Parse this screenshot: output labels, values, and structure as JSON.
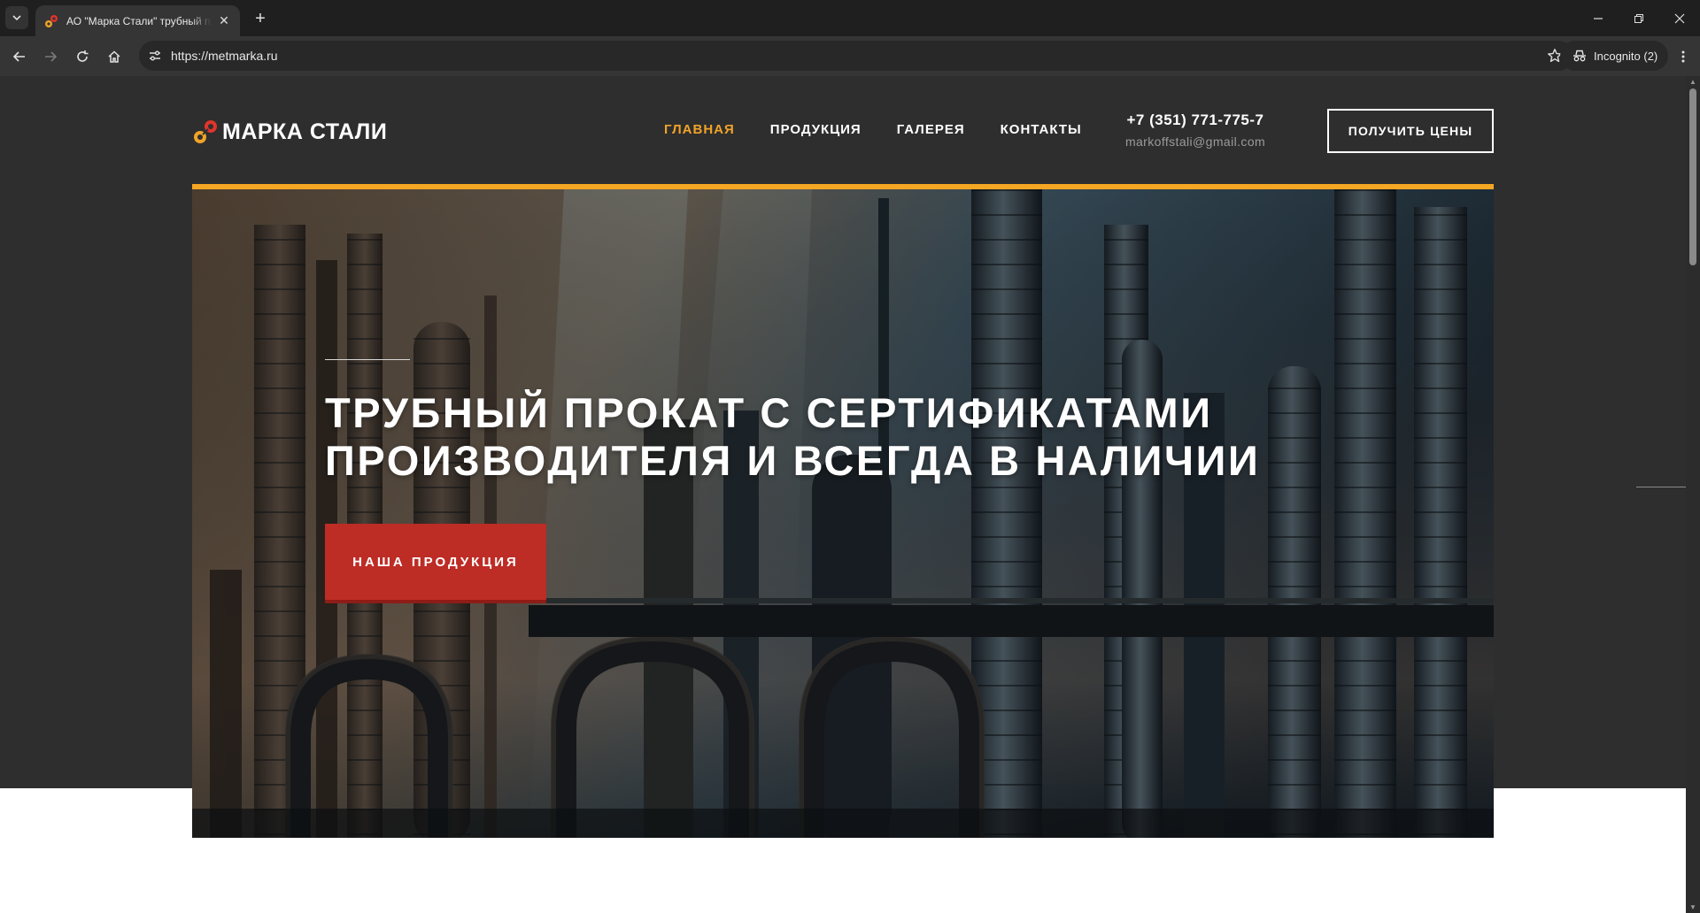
{
  "browser": {
    "tab_title": "АО \"Марка Стали\" трубный прокат",
    "url": "https://metmarka.ru",
    "incognito_label": "Incognito (2)"
  },
  "site": {
    "logo_text": "МАРКА СТАЛИ",
    "nav": [
      {
        "label": "ГЛАВНАЯ",
        "active": true
      },
      {
        "label": "ПРОДУКЦИЯ",
        "active": false
      },
      {
        "label": "ГАЛЕРЕЯ",
        "active": false
      },
      {
        "label": "КОНТАКТЫ",
        "active": false
      }
    ],
    "phone": "+7 (351) 771-775-7",
    "email": "markoffstali@gmail.com",
    "price_button": "ПОЛУЧИТЬ ЦЕНЫ"
  },
  "hero": {
    "headline_line1": "ТРУБНЫЙ ПРОКАТ С СЕРТИФИКАТАМИ",
    "headline_line2": "ПРОИЗВОДИТЕЛЯ И ВСЕГДА В НАЛИЧИИ",
    "cta_label": "НАША ПРОДУКЦИЯ"
  },
  "colors": {
    "accent": "#f0a329",
    "hero_border": "#f5a623",
    "cta_red": "#bd2c25",
    "header_bg": "#2e2e2e"
  }
}
